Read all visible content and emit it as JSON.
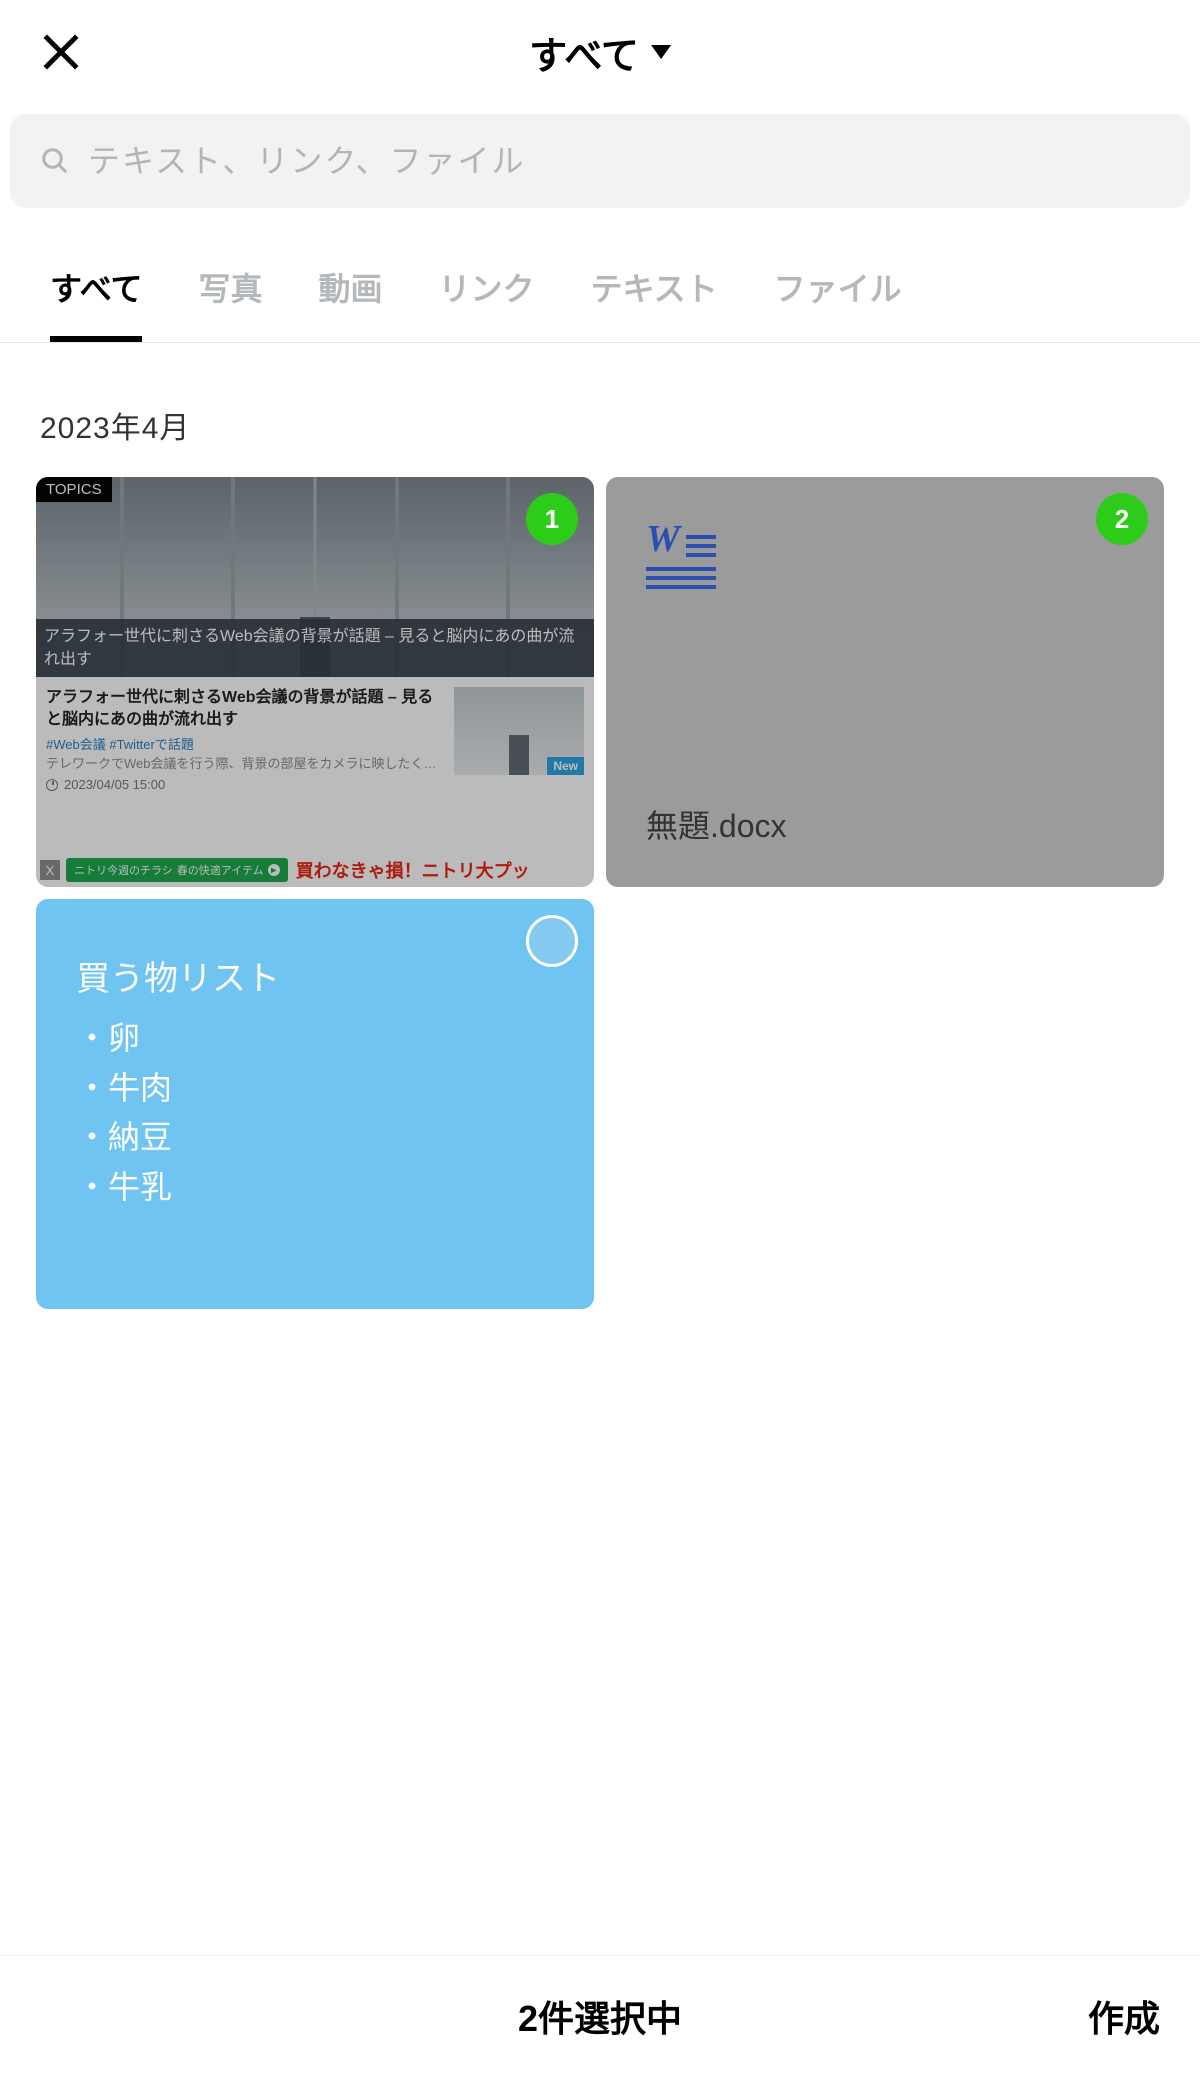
{
  "header": {
    "title": "すべて"
  },
  "search": {
    "placeholder": "テキスト、リンク、ファイル"
  },
  "tabs": [
    {
      "label": "すべて",
      "active": true
    },
    {
      "label": "写真",
      "active": false
    },
    {
      "label": "動画",
      "active": false
    },
    {
      "label": "リンク",
      "active": false
    },
    {
      "label": "テキスト",
      "active": false
    },
    {
      "label": "ファイル",
      "active": false
    }
  ],
  "section_date": "2023年4月",
  "cards": {
    "article": {
      "selection_index": "1",
      "topics_tag": "TOPICS",
      "hero_caption": "アラフォー世代に刺さるWeb会議の背景が話題 – 見ると脳内にあの曲が流れ出す",
      "body_title": "アラフォー世代に刺さるWeb会議の背景が話題 – 見ると脳内にあの曲が流れ出す",
      "body_tags": "#Web会議 #Twitterで話題",
      "body_desc": "テレワークでWeb会議を行う際、背景の部屋をカメラに映したく…",
      "body_date": "2023/04/05 15:00",
      "thumb_badge": "New",
      "ad_close": "X",
      "ad_green_label": "ニトリ今週のチラシ",
      "ad_green_sub": "春の快適アイテム",
      "ad_red_text": "買わなきゃ損！ニトリ大プッ"
    },
    "file": {
      "selection_index": "2",
      "word_letter": "W",
      "filename": "無題.docx"
    },
    "note": {
      "title": "買う物リスト",
      "items": [
        "卵",
        "牛肉",
        "納豆",
        "牛乳"
      ]
    }
  },
  "footer": {
    "status": "2件選択中",
    "action": "作成"
  }
}
